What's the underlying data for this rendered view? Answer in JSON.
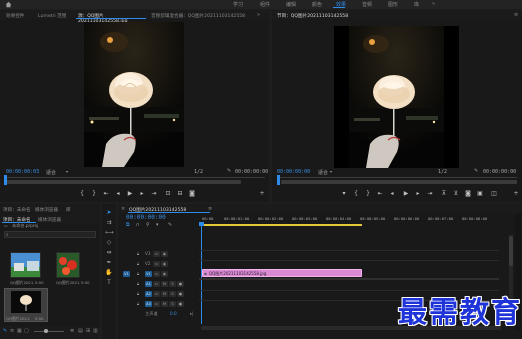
{
  "workspaces": {
    "items": [
      "学习",
      "组件",
      "编辑",
      "颜色",
      "效果",
      "音频",
      "图形",
      "库"
    ],
    "active_index": 4
  },
  "source_panel": {
    "tabs": [
      "效果控件",
      "Lumetri 范围",
      "源：QQ图片20211103142558.jpg",
      "音频剪辑混合器：QQ图片20211103142558"
    ],
    "active_tab": 2,
    "timecode_in": "00:00:00:03",
    "fit_label": "适合",
    "resolution": "1/2",
    "timecode_out": "00:00:00:00"
  },
  "program_panel": {
    "title": "节目：QQ图片20211103142558",
    "timecode_in": "00:00:00:00",
    "fit_label": "适合",
    "resolution": "1/2",
    "timecode_out": "00:00:00:00"
  },
  "project_panel": {
    "tabs": [
      "项目：未命名",
      "媒体浏览器",
      "库"
    ],
    "bin_tabs": [
      "项目：未命名",
      "媒体浏览器"
    ],
    "project_file": "未命名.prproj",
    "search_placeholder": "",
    "items": [
      {
        "label": "QQ图片2021...",
        "duration": "5:00"
      },
      {
        "label": "QQ图片2021...",
        "duration": "5:00"
      },
      {
        "label": "QQ图片2021...",
        "duration": "5:00"
      }
    ]
  },
  "timeline": {
    "tab": "QQ图片20211103142558",
    "timecode": "00:00:00:00",
    "ruler": [
      "00:00",
      "00:00:01:00",
      "00:00:02:00",
      "00:00:03:00",
      "00:00:04:00",
      "00:00:05:00",
      "00:00:06:00",
      "00:00:07:00",
      "00:00:08:00"
    ],
    "video_tracks": [
      "V3",
      "V2",
      "V1"
    ],
    "audio_tracks": [
      "A1",
      "A2",
      "A3"
    ],
    "master_label": "主声道",
    "master_value": "0.0",
    "clip": {
      "label": "QQ图片20211103142558.jpg",
      "color": "#d98ad3"
    }
  },
  "watermark": "最需教育",
  "colors": {
    "accent": "#2d8ceb",
    "clip": "#d98ad3",
    "watermark": "#1e34d8"
  }
}
